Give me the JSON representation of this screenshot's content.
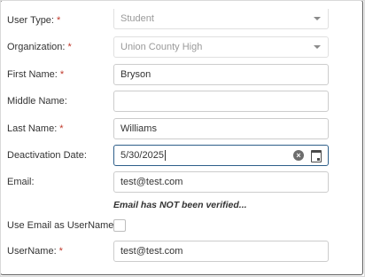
{
  "form": {
    "user_type": {
      "label": "User Type:",
      "required": "*",
      "value": "Student"
    },
    "organization": {
      "label": "Organization:",
      "required": "*",
      "value": "Union County High"
    },
    "first_name": {
      "label": "First Name:",
      "required": "*",
      "value": "Bryson"
    },
    "middle_name": {
      "label": "Middle Name:",
      "value": ""
    },
    "last_name": {
      "label": "Last Name:",
      "required": "*",
      "value": "Williams"
    },
    "deactivation_date": {
      "label": "Deactivation Date:",
      "value": "5/30/2025"
    },
    "email": {
      "label": "Email:",
      "value": "test@test.com"
    },
    "email_warning": "Email has NOT been verified...",
    "use_email_as_username": {
      "label": "Use Email as UserName:",
      "checked": false
    },
    "username": {
      "label": "UserName:",
      "required": "*",
      "value": "test@test.com"
    }
  },
  "icons": {
    "select_caret": "chevron-down-icon",
    "clear": "clear-circle-icon",
    "calendar": "calendar-icon"
  },
  "colors": {
    "required_marker": "#c0392b",
    "active_border": "#2e5f8a",
    "frame_border": "#5c5c5c"
  }
}
